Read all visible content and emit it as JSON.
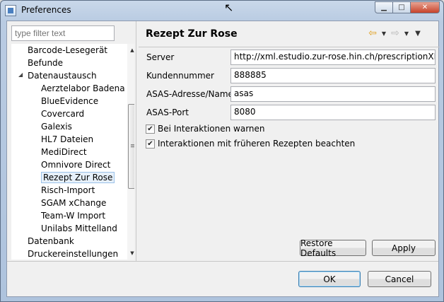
{
  "window": {
    "title": "Preferences"
  },
  "filter": {
    "placeholder": "type filter text"
  },
  "tree": {
    "items": [
      {
        "label": "Barcode-Lesegerät"
      },
      {
        "label": "Befunde"
      },
      {
        "label": "Datenaustausch"
      },
      {
        "label": "Aerztelabor Badena"
      },
      {
        "label": "BlueEvidence"
      },
      {
        "label": "Covercard"
      },
      {
        "label": "Galexis"
      },
      {
        "label": "HL7 Dateien"
      },
      {
        "label": "MediDirect"
      },
      {
        "label": "Omnivore Direct"
      },
      {
        "label": "Rezept Zur Rose"
      },
      {
        "label": "Risch-Import"
      },
      {
        "label": "SGAM xChange"
      },
      {
        "label": "Team-W Import"
      },
      {
        "label": "Unilabs Mittelland"
      },
      {
        "label": "Datenbank"
      },
      {
        "label": "Druckereinstellungen"
      }
    ]
  },
  "page": {
    "title": "Rezept Zur Rose"
  },
  "form": {
    "server_label": "Server",
    "server_value": "http://xml.estudio.zur-rose.hin.ch/prescriptionXML/",
    "kundennummer_label": "Kundennummer",
    "kundennummer_value": "888885",
    "asas_label": "ASAS-Adresse/Name",
    "asas_value": "asas",
    "port_label": "ASAS-Port",
    "port_value": "8080",
    "check1_label": "Bei Interaktionen warnen",
    "check2_label": "Interaktionen mit früheren Rezepten beachten"
  },
  "buttons": {
    "restore": "Restore Defaults",
    "apply": "Apply",
    "ok": "OK",
    "cancel": "Cancel"
  },
  "colors": {
    "accent": "#3c7fb1",
    "nav_back": "#e0a020"
  }
}
